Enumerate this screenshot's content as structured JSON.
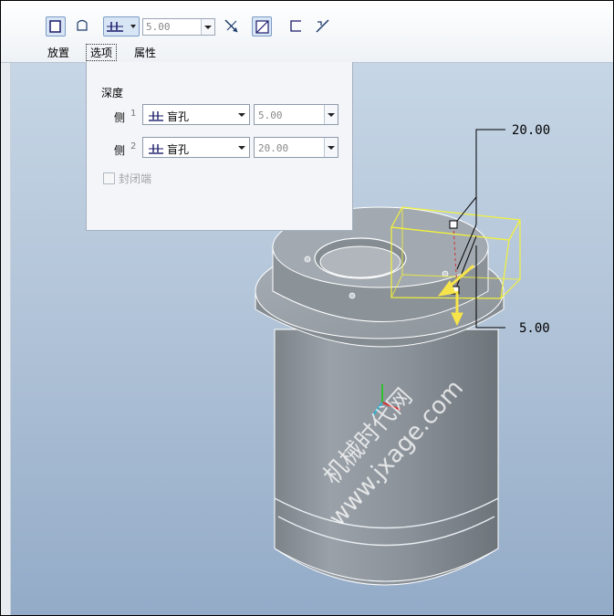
{
  "toolbar": {
    "depth_value": "5.00",
    "tabs": {
      "placement": "放置",
      "options": "选项",
      "properties": "属性"
    }
  },
  "panel": {
    "depth_heading": "深度",
    "side1": {
      "label": "侧",
      "index": "1",
      "type": "盲孔",
      "value": "5.00"
    },
    "side2": {
      "label": "侧",
      "index": "2",
      "type": "盲孔",
      "value": "20.00"
    },
    "capped_ends_label": "封闭端",
    "capped_ends_checked": false
  },
  "viewport": {
    "dimension_top": "20.00",
    "dimension_bottom": "5.00",
    "watermark_line1": "机械时代网",
    "watermark_line2": "www.jxage.com"
  },
  "colors": {
    "preview_box": "#f2f23a",
    "preview_arrow": "#f7e44a",
    "model_body": "#8f969d",
    "background_top": "#c6d6e6",
    "background_bottom": "#93abc8",
    "active_button": "#d7e5f5"
  }
}
